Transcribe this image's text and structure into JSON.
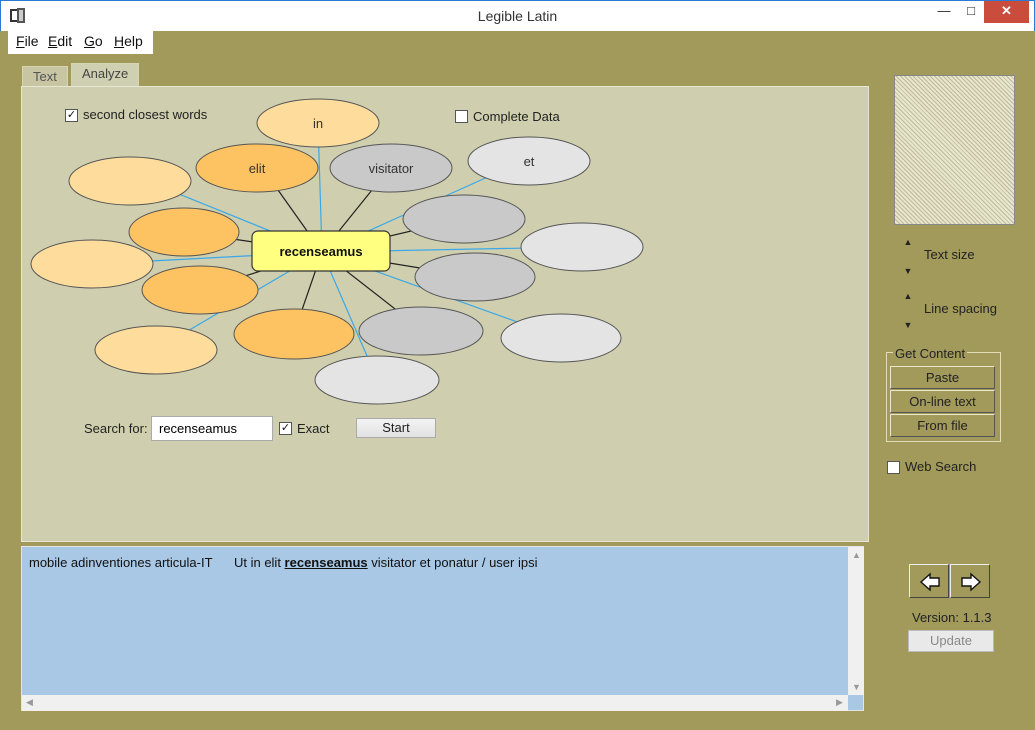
{
  "window": {
    "title": "Legible Latin",
    "controls": {
      "minimize": "—",
      "maximize": "□",
      "close": "✕"
    }
  },
  "menu": [
    {
      "label": "File",
      "underline": "F",
      "rest": "ile"
    },
    {
      "label": "Edit",
      "underline": "E",
      "rest": "dit"
    },
    {
      "label": "Go",
      "underline": "G",
      "rest": "o"
    },
    {
      "label": "Help",
      "underline": "H",
      "rest": "elp"
    }
  ],
  "tabs": [
    {
      "label": "Text",
      "active": false
    },
    {
      "label": "Analyze",
      "active": true
    }
  ],
  "analyze": {
    "second_closest_label": "second closest words",
    "second_closest_checked": true,
    "complete_data_label": "Complete Data",
    "complete_data_checked": false,
    "center_word": "recenseamus",
    "labeled_nodes": [
      "in",
      "elit",
      "visitator",
      "et"
    ],
    "search_label": "Search for:",
    "search_value": "recenseamus",
    "exact_label": "Exact",
    "exact_checked": true,
    "start_label": "Start"
  },
  "sidebar": {
    "text_size_label": "Text size",
    "line_spacing_label": "Line spacing",
    "get_content_title": "Get Content",
    "content_buttons": [
      "Paste",
      "On-line text",
      "From file"
    ],
    "web_search_label": "Web Search",
    "web_search_checked": false,
    "version_label": "Version:  1.1.3",
    "update_label": "Update"
  },
  "text_panel": {
    "prefix": "mobile adinventiones articula-IT      Ut in elit ",
    "highlight": "recenseamus",
    "suffix": " visitator et ponatur / user ipsi"
  },
  "colors": {
    "background": "#a19a5b",
    "panel": "#cfcfaf",
    "center_node": "#ffff80",
    "orange_light": "#fedc9c",
    "orange": "#fdc363",
    "gray": "#c9c9c9",
    "gray_light": "#e4e4e4",
    "link_blue": "#3aa8e8",
    "link_dark": "#222222",
    "text_area": "#a9c8e6"
  }
}
